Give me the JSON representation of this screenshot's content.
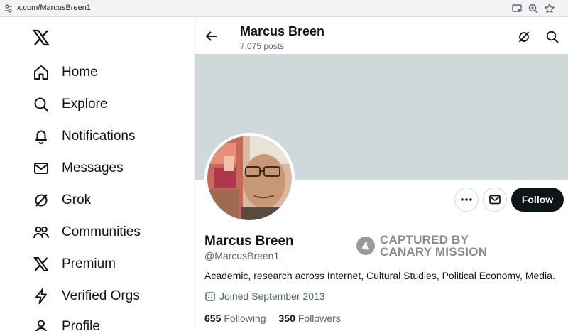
{
  "browser": {
    "url": "x.com/MarcusBreen1"
  },
  "sidebar": {
    "items": [
      {
        "label": "Home",
        "icon": "home-icon"
      },
      {
        "label": "Explore",
        "icon": "search-icon"
      },
      {
        "label": "Notifications",
        "icon": "bell-icon"
      },
      {
        "label": "Messages",
        "icon": "mail-icon"
      },
      {
        "label": "Grok",
        "icon": "grok-icon"
      },
      {
        "label": "Communities",
        "icon": "people-icon"
      },
      {
        "label": "Premium",
        "icon": "x-icon"
      },
      {
        "label": "Verified Orgs",
        "icon": "bolt-icon"
      },
      {
        "label": "Profile",
        "icon": "person-icon"
      }
    ]
  },
  "header": {
    "name": "Marcus Breen",
    "posts": "7,075 posts"
  },
  "profile": {
    "name": "Marcus Breen",
    "handle": "@MarcusBreen1",
    "bio": "Academic, research across Internet, Cultural Studies, Political Economy, Media.",
    "joined": "Joined September 2013",
    "following_count": "655",
    "following_label": "Following",
    "followers_count": "350",
    "followers_label": "Followers",
    "follow_button": "Follow"
  },
  "watermark": {
    "line1": "CAPTURED BY",
    "line2": "CANARY MISSION"
  },
  "colors": {
    "banner": "#cfd9da",
    "follow_bg": "#0f1419",
    "muted": "#536471"
  }
}
